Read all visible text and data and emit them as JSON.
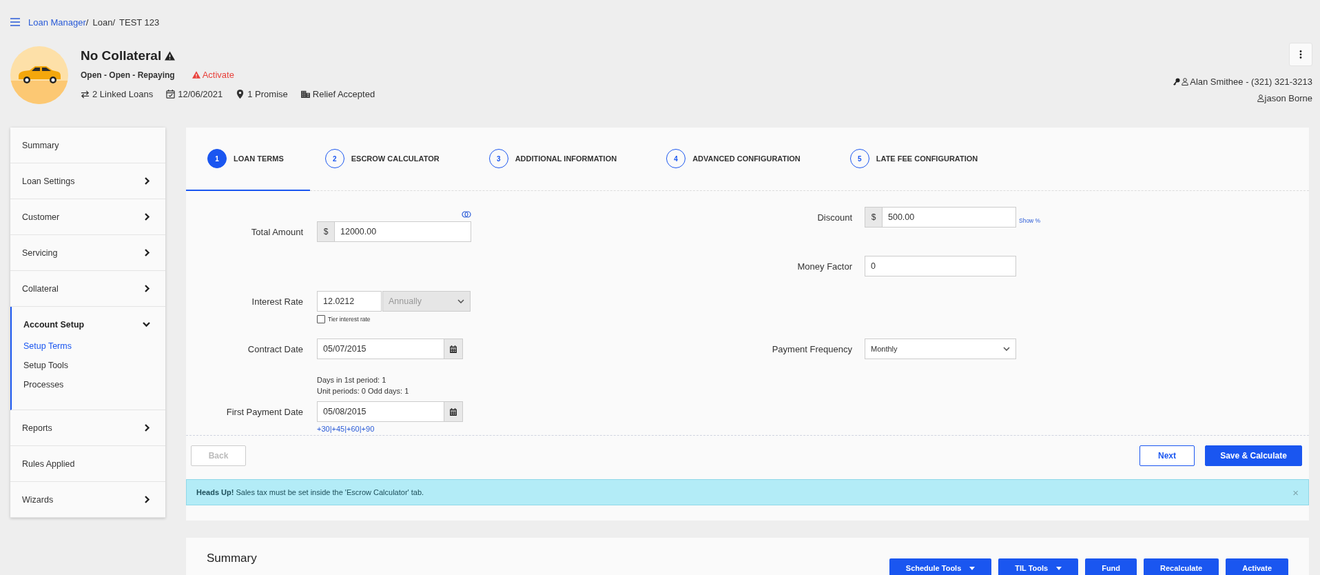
{
  "breadcrumb": [
    {
      "label": "Loan Manager",
      "link": true,
      "separator": "/"
    },
    {
      "label": "Loan",
      "link": false,
      "separator": "/"
    },
    {
      "label": "TEST 123",
      "link": false
    }
  ],
  "header": {
    "title": "No Collateral",
    "status": "Open - Open - Repaying",
    "activate": "Activate",
    "meta": [
      {
        "kind": "linked",
        "label": "2 Linked Loans"
      },
      {
        "kind": "date",
        "label": "12/06/2021"
      },
      {
        "kind": "promise",
        "label": "1 Promise"
      },
      {
        "kind": "relief",
        "label": "Relief Accepted"
      }
    ],
    "contact": "Alan Smithee - (321) 321-3213",
    "agent": "jason Borne"
  },
  "sidebar": {
    "items": [
      {
        "label": "Summary",
        "submenu": false,
        "expanded": false
      },
      {
        "label": "Loan Settings",
        "submenu": true,
        "expanded": false
      },
      {
        "label": "Customer",
        "submenu": true,
        "expanded": false
      },
      {
        "label": "Servicing",
        "submenu": true,
        "expanded": false
      },
      {
        "label": "Collateral",
        "submenu": true,
        "expanded": false
      },
      {
        "label": "Account Setup",
        "submenu": true,
        "expanded": true,
        "children": [
          {
            "label": "Setup Terms",
            "selected": true
          },
          {
            "label": "Setup Tools",
            "selected": false
          },
          {
            "label": "Processes",
            "selected": false
          }
        ]
      },
      {
        "label": "Reports",
        "submenu": true,
        "expanded": false
      },
      {
        "label": "Rules Applied",
        "submenu": false,
        "expanded": false
      },
      {
        "label": "Wizards",
        "submenu": true,
        "expanded": false
      }
    ]
  },
  "steps": [
    {
      "number": "1",
      "label": "LOAN TERMS",
      "selected": true
    },
    {
      "number": "2",
      "label": "ESCROW CALCULATOR",
      "selected": false
    },
    {
      "number": "3",
      "label": "ADDITIONAL INFORMATION",
      "selected": false
    },
    {
      "number": "4",
      "label": "ADVANCED CONFIGURATION",
      "selected": false
    },
    {
      "number": "5",
      "label": "LATE FEE CONFIGURATION",
      "selected": false
    }
  ],
  "form": {
    "total_amount": {
      "label": "Total Amount",
      "prefix": "$",
      "value": "12000.00"
    },
    "interest_rate": {
      "label": "Interest Rate",
      "value": "12.0212",
      "period": "Annually",
      "period_disabled": true,
      "tier_label": "Tier interest rate",
      "tier_checked": false
    },
    "contract_date": {
      "label": "Contract Date",
      "value": "05/07/2015"
    },
    "notes": [
      "Days in 1st period: 1",
      "Unit periods: 0 Odd days: 1"
    ],
    "first_payment_date": {
      "label": "First Payment Date",
      "value": "05/08/2015",
      "shortcuts": [
        "+30",
        "|+45",
        "|+60",
        "|+90"
      ]
    },
    "discount": {
      "label": "Discount",
      "prefix": "$",
      "value": "500.00",
      "toggle": "Show %"
    },
    "money_factor": {
      "label": "Money Factor",
      "value": "0"
    },
    "payment_frequency": {
      "label": "Payment Frequency",
      "value": "Monthly"
    }
  },
  "footer_buttons": [
    {
      "label": "Back",
      "kind": "outline",
      "disabled": true
    },
    {
      "label": "Next",
      "kind": "outline",
      "disabled": false
    },
    {
      "label": "Save & Calculate",
      "kind": "primary",
      "disabled": false
    }
  ],
  "alert": {
    "text": "**Heads Up!** Sales tax must be set inside the 'Escrow Calculator' tab.",
    "close": "×"
  },
  "summary": {
    "title": "Summary",
    "buttons": [
      {
        "label": "Schedule Tools",
        "dropdown": true
      },
      {
        "label": "TIL Tools",
        "dropdown": true
      },
      {
        "label": "Fund",
        "dropdown": false
      },
      {
        "label": "Recalculate",
        "dropdown": false
      },
      {
        "label": "Activate",
        "dropdown": false
      }
    ]
  }
}
